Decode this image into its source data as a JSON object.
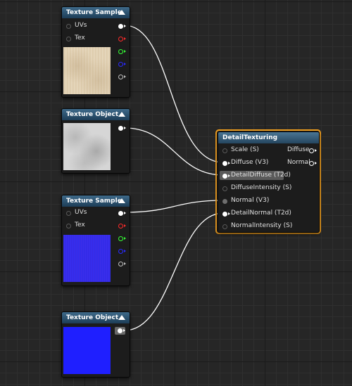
{
  "nodes": {
    "texture_sample_1": {
      "title": "Texture Sample",
      "inputs": [
        "UVs",
        "Tex"
      ]
    },
    "texture_object_1": {
      "title": "Texture Object"
    },
    "texture_sample_2": {
      "title": "Texture Sample",
      "inputs": [
        "UVs",
        "Tex"
      ]
    },
    "texture_object_2": {
      "title": "Texture Object"
    },
    "detail_texturing": {
      "title": "DetailTexturing",
      "inputs": [
        "Scale (S)",
        "Diffuse (V3)",
        "DetailDiffuse (T2d)",
        "DiffuseIntensity (S)",
        "Normal (V3)",
        "DetailNormal (T2d)",
        "NormalIntensity (S)"
      ],
      "outputs": [
        "Diffuse",
        "Normal"
      ]
    }
  },
  "colors": {
    "header_top": "#3e6a8a",
    "header_bottom": "#1d3d57",
    "selection": "#f2a020",
    "wire": "#ffffff",
    "pin_red": "#ff2a2a",
    "pin_green": "#35ff35",
    "pin_blue": "#2a2aff"
  },
  "icons": {
    "collapse": "collapse-arrow-icon",
    "pin_connected": "connected-pin-icon",
    "pin_empty": "empty-pin-icon"
  }
}
